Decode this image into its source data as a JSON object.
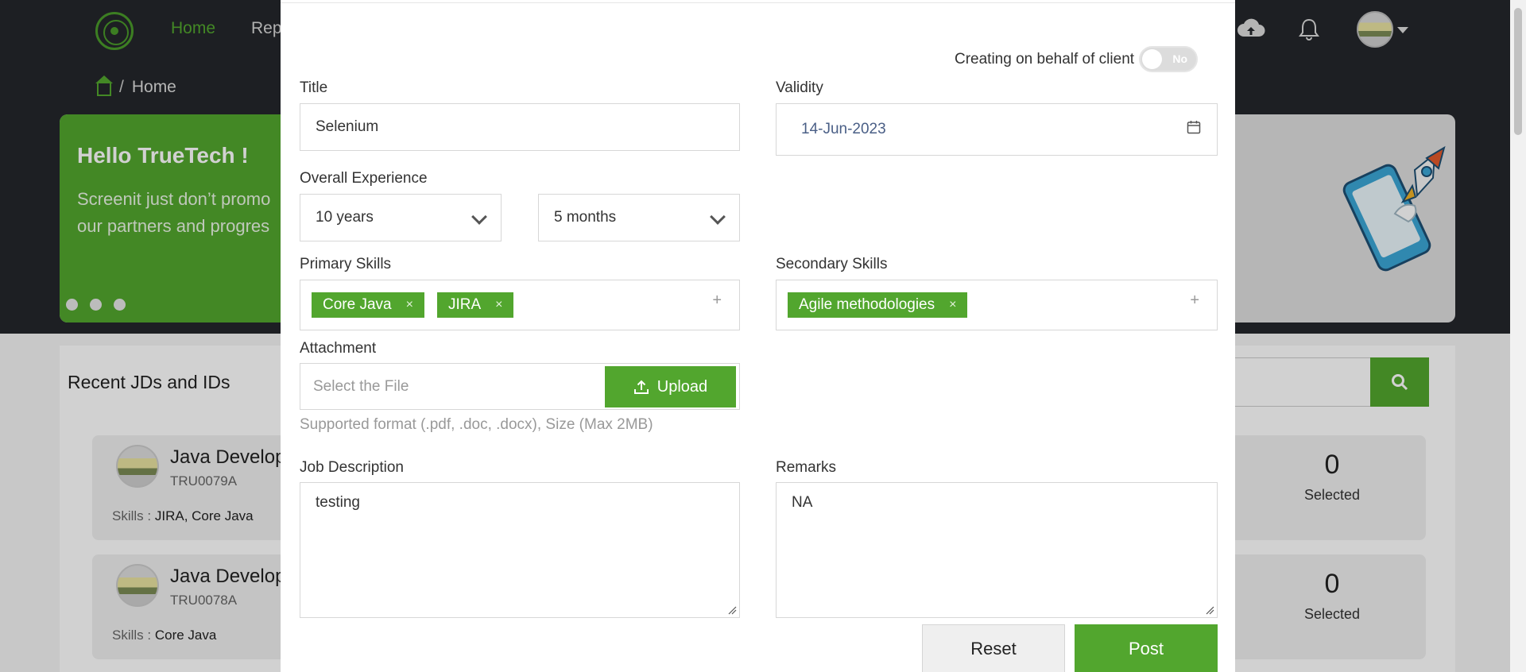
{
  "nav": {
    "home": "Home",
    "reports_partial": "Rep"
  },
  "breadcrumb": {
    "current": "Home"
  },
  "hero": {
    "title": "Hello TrueTech !",
    "text_line1": "Screenit just don’t promo",
    "text_line2": "our partners and progres"
  },
  "recent": {
    "title": "Recent JDs and IDs",
    "cards": [
      {
        "name": "Java Develop",
        "code": "TRU0079A",
        "skills_label": "Skills :",
        "skills": "JIRA, Core Java",
        "selected_count": "0",
        "selected_label": "Selected"
      },
      {
        "name": "Java Develop",
        "code": "TRU0078A",
        "skills_label": "Skills :",
        "skills": "Core Java",
        "selected_count": "0",
        "selected_label": "Selected"
      }
    ]
  },
  "form": {
    "behalf_label": "Creating on behalf of client",
    "behalf_toggle": "No",
    "title_label": "Title",
    "title_value": "Selenium",
    "validity_label": "Validity",
    "validity_value": "14-Jun-2023",
    "experience_label": "Overall Experience",
    "experience_years": "10 years",
    "experience_months": "5 months",
    "primary_label": "Primary Skills",
    "primary_skills": [
      "Core Java",
      "JIRA"
    ],
    "secondary_label": "Secondary Skills",
    "secondary_skills": [
      "Agile methodologies"
    ],
    "remove_glyph": "×",
    "add_glyph": "+",
    "attachment_label": "Attachment",
    "attachment_placeholder": "Select the File",
    "upload_label": "Upload",
    "attachment_hint": "Supported format (.pdf, .doc, .docx), Size (Max 2MB)",
    "jd_label": "Job Description",
    "jd_value": "testing",
    "remarks_label": "Remarks",
    "remarks_value": "NA",
    "reset_label": "Reset",
    "post_label": "Post"
  },
  "colors": {
    "accent": "#52a62e",
    "dark_header": "#24272b"
  }
}
